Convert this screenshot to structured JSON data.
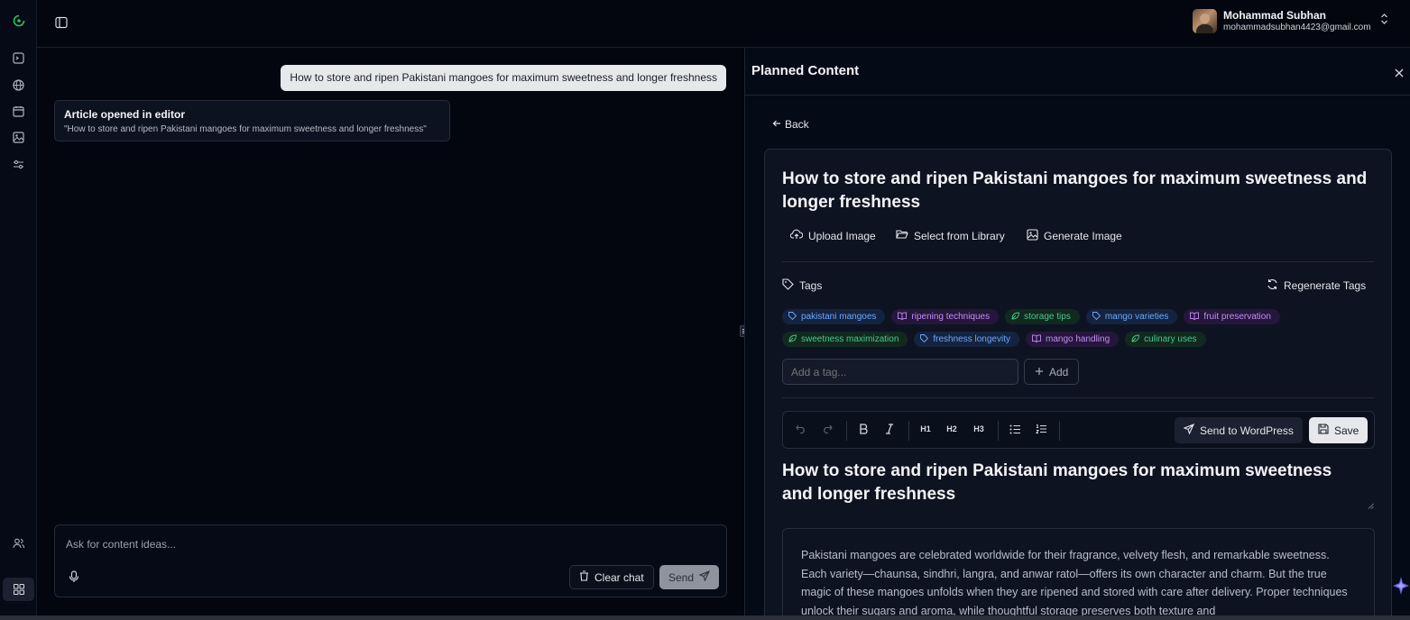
{
  "user": {
    "name": "Mohammad Subhan",
    "email": "mohammadsubhan4423@gmail.com"
  },
  "chat": {
    "user_message": "How to store and ripen Pakistani mangoes for maximum sweetness and longer freshness",
    "system_card_title": "Article opened in editor",
    "system_card_subtitle": "\"How to store and ripen Pakistani mangoes for maximum sweetness and longer freshness\"",
    "input_placeholder": "Ask for content ideas...",
    "clear_label": "Clear chat",
    "send_label": "Send"
  },
  "panel": {
    "title": "Planned Content",
    "back_label": "Back",
    "article_title": "How to store and ripen Pakistani mangoes for maximum sweetness and longer freshness",
    "upload_label": "Upload Image",
    "library_label": "Select from Library",
    "generate_label": "Generate Image",
    "tags_label": "Tags",
    "regenerate_label": "Regenerate Tags",
    "tags": [
      {
        "label": "pakistani mangoes",
        "color": "blue",
        "icon": "tag-icon"
      },
      {
        "label": "ripening techniques",
        "color": "purple",
        "icon": "book-icon"
      },
      {
        "label": "storage tips",
        "color": "green",
        "icon": "leaf-icon"
      },
      {
        "label": "mango varieties",
        "color": "blue",
        "icon": "tag-icon"
      },
      {
        "label": "fruit preservation",
        "color": "purple",
        "icon": "book-icon"
      },
      {
        "label": "sweetness maximization",
        "color": "green",
        "icon": "leaf-icon"
      },
      {
        "label": "freshness longevity",
        "color": "blue",
        "icon": "tag-icon"
      },
      {
        "label": "mango handling",
        "color": "purple",
        "icon": "book-icon"
      },
      {
        "label": "culinary uses",
        "color": "green",
        "icon": "leaf-icon"
      }
    ],
    "tag_input_placeholder": "Add a tag...",
    "add_label": "Add",
    "toolbar": {
      "h1": "H1",
      "h2": "H2",
      "h3": "H3",
      "send_wp_label": "Send to WordPress",
      "save_label": "Save"
    },
    "editor_heading": "How to store and ripen Pakistani mangoes for maximum sweetness and longer freshness",
    "body_text": "Pakistani mangoes are celebrated worldwide for their fragrance, velvety flesh, and remarkable sweetness. Each variety—chaunsa, sindhri, langra, and anwar ratol—offers its own character and charm. But the true magic of these mangoes unfolds when they are ripened and stored with care after delivery. Proper techniques unlock their sugars and aroma, while thoughtful storage preserves both texture and"
  },
  "colors": {
    "accent_green": "#22c55e",
    "background": "#03060f",
    "panel": "#0e1322"
  }
}
